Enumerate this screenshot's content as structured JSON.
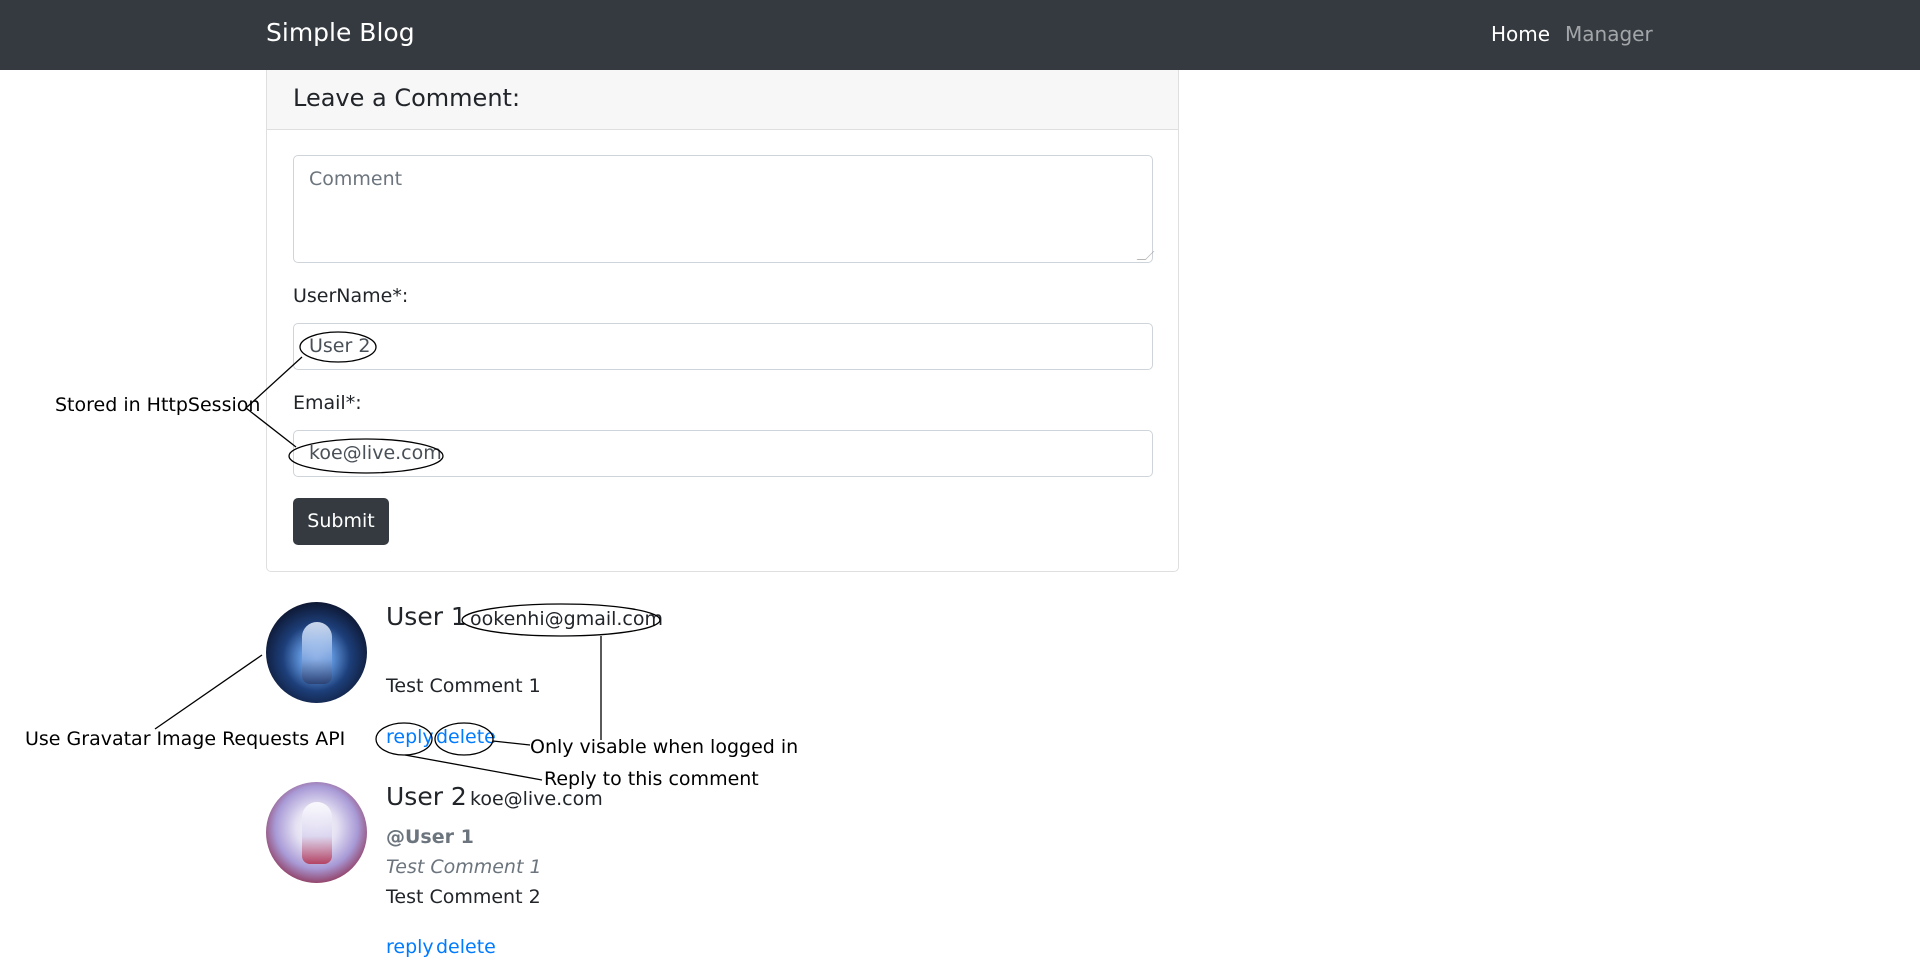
{
  "navbar": {
    "brand": "Simple Blog",
    "links": [
      "Home",
      "Manager"
    ]
  },
  "comment_form": {
    "title": "Leave a Comment:",
    "comment_placeholder": "Comment",
    "username_label": "UserName*:",
    "username_value": "User 2",
    "email_label": "Email*:",
    "email_value": "koe@live.com",
    "submit_label": "Submit"
  },
  "comments": [
    {
      "name": "User 1",
      "email": "ookenhi@gmail.com",
      "text": "Test Comment 1",
      "reply_label": "reply",
      "delete_label": "delete"
    },
    {
      "name": "User 2",
      "email": "koe@live.com",
      "mention": "@User 1",
      "quoted_text": "Test Comment 1",
      "text": "Test Comment 2",
      "reply_label": "reply",
      "delete_label": "delete"
    }
  ],
  "annotations": {
    "session": "Stored in HttpSession",
    "gravatar": "Use Gravatar Image Requests API",
    "logged_in": "Only visable when logged in",
    "reply": "Reply to this comment"
  },
  "colors": {
    "navbar_bg": "#343a40",
    "link": "#007bff",
    "button_bg": "#343a40"
  }
}
